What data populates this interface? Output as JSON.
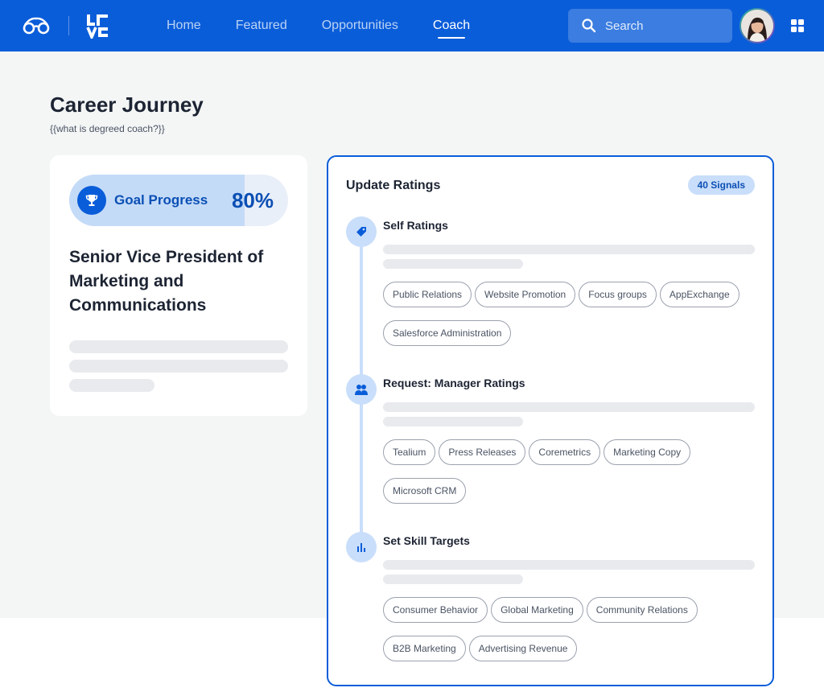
{
  "nav": {
    "items": [
      {
        "label": "Home",
        "active": false
      },
      {
        "label": "Featured",
        "active": false
      },
      {
        "label": "Opportunities",
        "active": false
      },
      {
        "label": "Coach",
        "active": true
      }
    ]
  },
  "search": {
    "placeholder": "Search"
  },
  "page": {
    "title": "Career Journey",
    "subtitle": "{{what is degreed coach?}}"
  },
  "goal": {
    "label": "Goal Progress",
    "value_text": "80%",
    "progress": 0.8,
    "role": "Senior Vice President of Marketing and Communications"
  },
  "ratings": {
    "title": "Update Ratings",
    "signals": "40 Signals",
    "steps": [
      {
        "title": "Self Ratings",
        "icon": "tag-icon",
        "tags": [
          "Public Relations",
          "Website Promotion",
          "Focus groups",
          "AppExchange",
          "Salesforce Administration"
        ]
      },
      {
        "title": "Request: Manager Ratings",
        "icon": "people-icon",
        "tags": [
          "Tealium",
          "Press Releases",
          "Coremetrics",
          "Marketing Copy",
          "Microsoft CRM"
        ]
      },
      {
        "title": "Set Skill Targets",
        "icon": "bar-chart-icon",
        "tags": [
          "Consumer Behavior",
          "Global Marketing",
          "Community Relations",
          "B2B Marketing",
          "Advertising Revenue"
        ]
      }
    ]
  },
  "colors": {
    "brand": "#0a5dd9",
    "accent_light": "#c9defa",
    "page_bg": "#f4f6f6"
  }
}
